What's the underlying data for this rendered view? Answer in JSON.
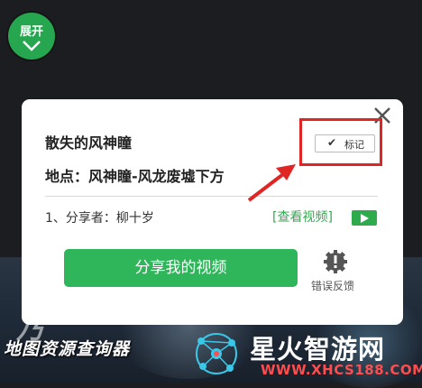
{
  "expand_button": {
    "label": "展开"
  },
  "map": {
    "title": "地图资源查询器"
  },
  "popup": {
    "title": "散失的风神瞳",
    "location": "地点：风神瞳-风龙废墟下方",
    "sharer": "1、分享者：柳十岁",
    "view_video_link": "[查看视频]",
    "mark_button": "标记",
    "share_button": "分享我的视频",
    "feedback_label": "错误反馈"
  },
  "watermark": {
    "brand": "星火智游网",
    "url": "WWW.XHCS188.COM"
  },
  "colors": {
    "accent_green": "#2fb55a",
    "highlight_red": "#e02525"
  }
}
